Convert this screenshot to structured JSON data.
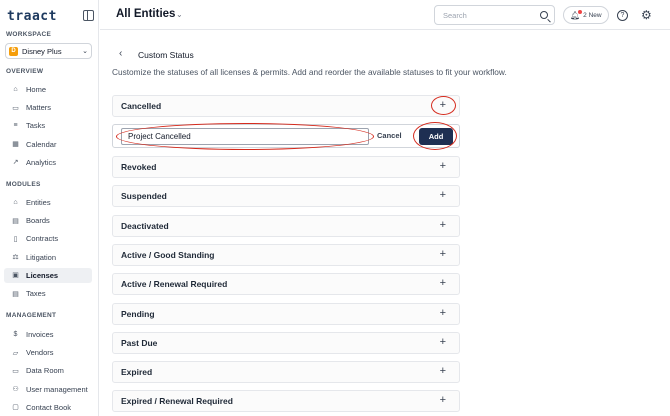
{
  "sidebar": {
    "logo": "traact",
    "workspace_label": "WORKSPACE",
    "workspace": {
      "badge": "D",
      "name": "Disney Plus"
    },
    "overview_label": "OVERVIEW",
    "overview": [
      {
        "label": "Home",
        "icon": "home-icon",
        "glyph": "⌂"
      },
      {
        "label": "Matters",
        "icon": "briefcase-icon",
        "glyph": "▭"
      },
      {
        "label": "Tasks",
        "icon": "list-icon",
        "glyph": "≡"
      },
      {
        "label": "Calendar",
        "icon": "calendar-icon",
        "glyph": "▦"
      },
      {
        "label": "Analytics",
        "icon": "chart-icon",
        "glyph": "↗"
      }
    ],
    "modules_label": "MODULES",
    "modules": [
      {
        "label": "Entities",
        "icon": "building-icon",
        "glyph": "⌂"
      },
      {
        "label": "Boards",
        "icon": "board-icon",
        "glyph": "▤"
      },
      {
        "label": "Contracts",
        "icon": "contract-icon",
        "glyph": "▯"
      },
      {
        "label": "Litigation",
        "icon": "gavel-icon",
        "glyph": "⚖"
      },
      {
        "label": "Licenses",
        "icon": "license-icon",
        "glyph": "▣",
        "active": true
      },
      {
        "label": "Taxes",
        "icon": "tax-icon",
        "glyph": "▤"
      }
    ],
    "management_label": "MANAGEMENT",
    "management": [
      {
        "label": "Invoices",
        "icon": "dollar-icon",
        "glyph": "$"
      },
      {
        "label": "Vendors",
        "icon": "vendor-icon",
        "glyph": "▱"
      },
      {
        "label": "Data Room",
        "icon": "folder-icon",
        "glyph": "▭"
      },
      {
        "label": "User management",
        "icon": "users-icon",
        "glyph": "⚇"
      },
      {
        "label": "Contact Book",
        "icon": "contact-book-icon",
        "glyph": "▢"
      }
    ]
  },
  "header": {
    "title": "All Entities",
    "search_placeholder": "Search",
    "notifications": "2 New"
  },
  "main": {
    "section_title": "Custom Status",
    "subtitle": "Customize the statuses of all licenses & permits. Add and reorder the available statuses to fit your workflow.",
    "first_status": "Cancelled",
    "new_status_value": "Project Cancelled",
    "cancel_label": "Cancel",
    "add_label": "Add",
    "statuses": [
      "Revoked",
      "Suspended",
      "Deactivated",
      "Active / Good Standing",
      "Active / Renewal Required",
      "Pending",
      "Past Due",
      "Expired",
      "Expired / Renewal Required"
    ]
  },
  "colors": {
    "primary": "#1e2f52",
    "annotation": "#d52b1e",
    "workspace_badge": "#f59e0b"
  }
}
